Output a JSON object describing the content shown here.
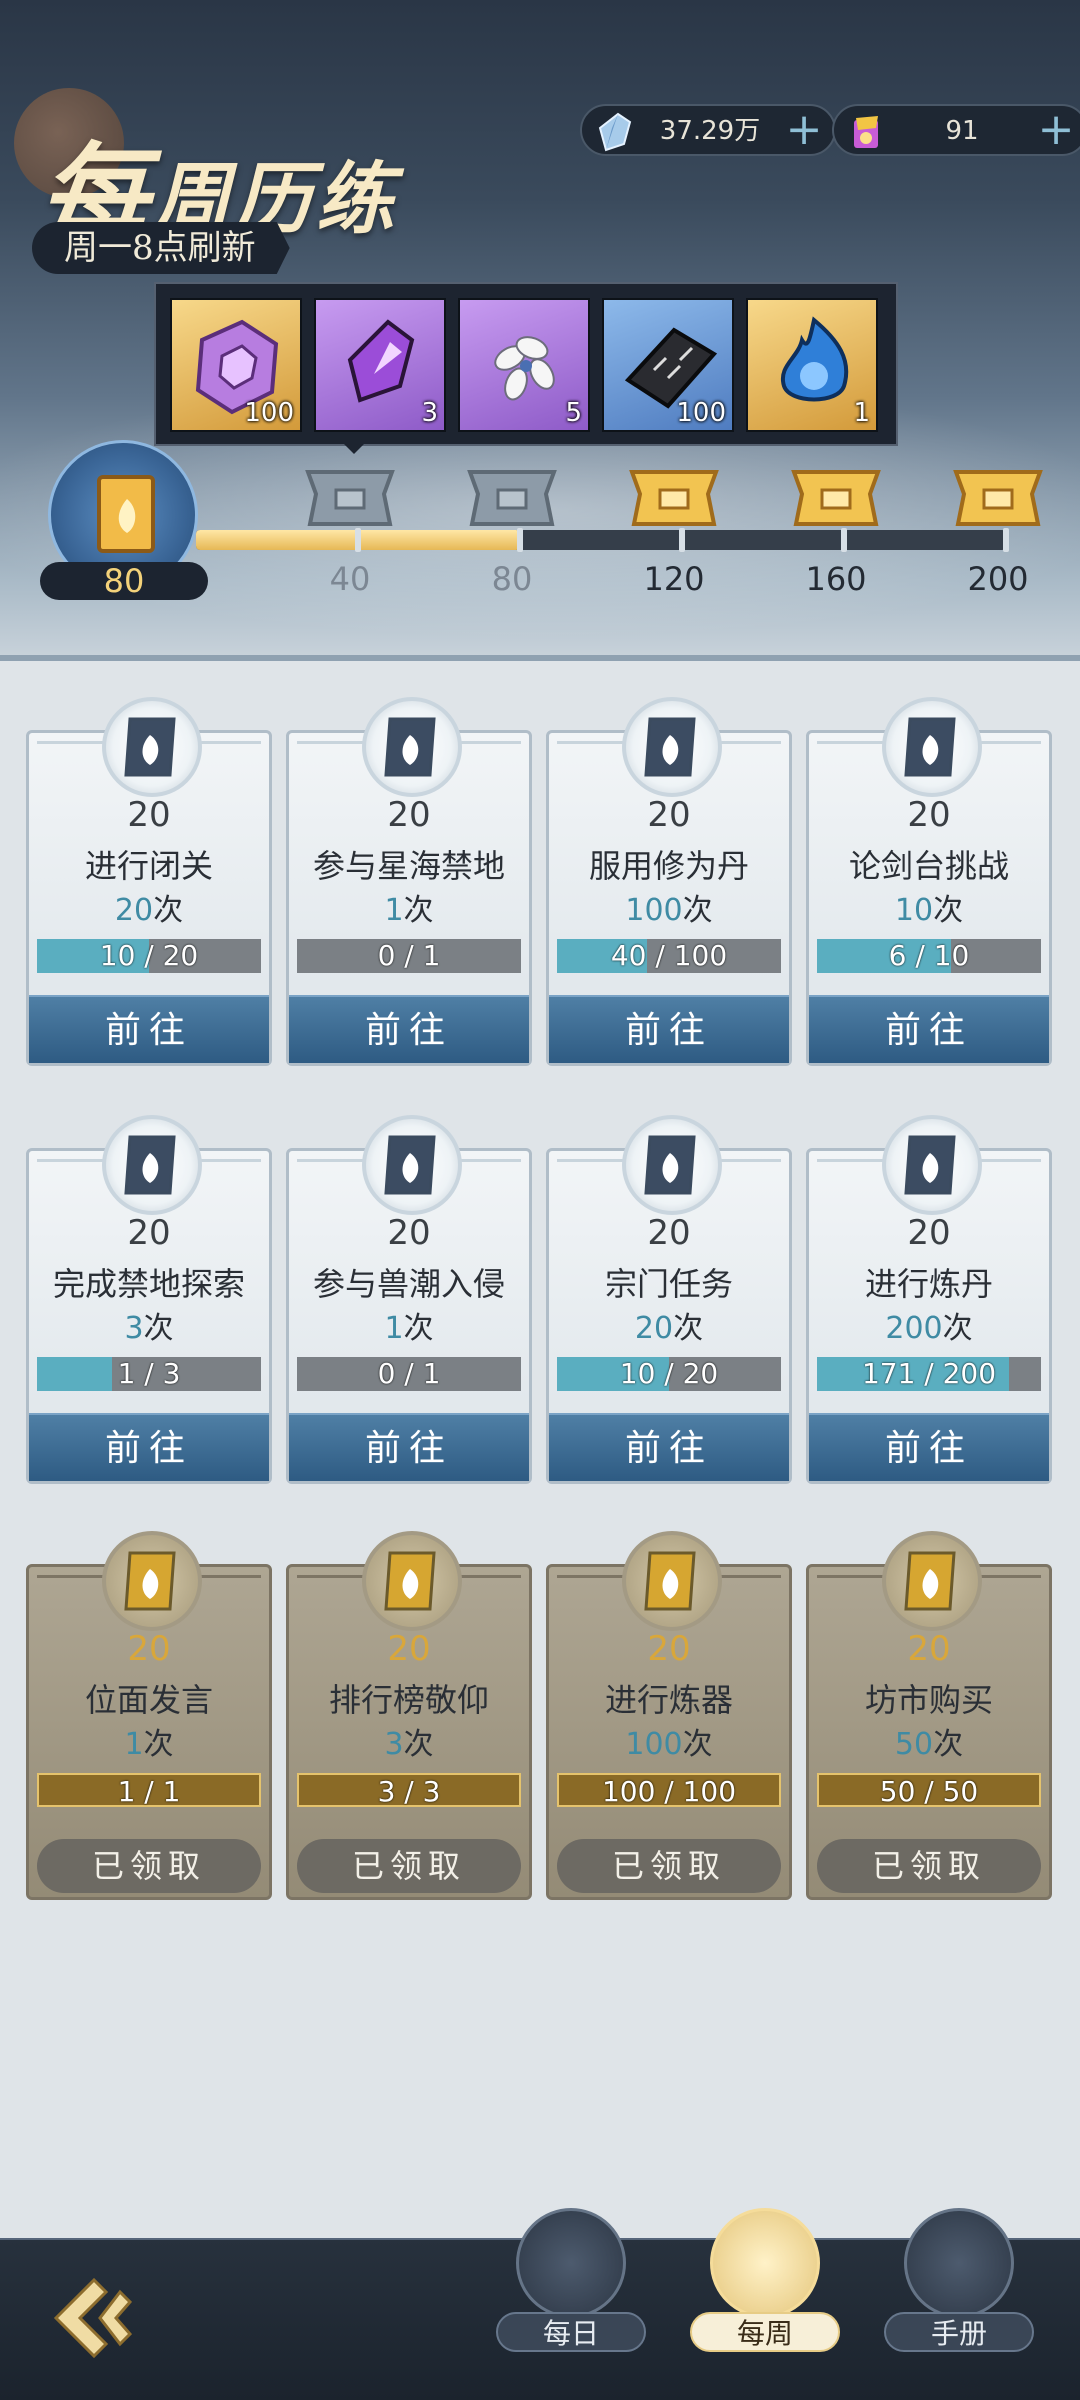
{
  "header": {
    "title_first": "每",
    "title_rest": "周历练",
    "refresh_note": "周一8点刷新"
  },
  "currencies": [
    {
      "icon": "spirit-stone-icon",
      "value": "37.29万",
      "plus": "+"
    },
    {
      "icon": "gold-scroll-icon",
      "value": "91",
      "plus": "+"
    }
  ],
  "reward_preview": [
    {
      "icon": "purple-ring-icon",
      "quality": "gold",
      "count": "100"
    },
    {
      "icon": "purple-crystal-icon",
      "quality": "purple",
      "count": "3"
    },
    {
      "icon": "white-flower-icon",
      "quality": "purple",
      "count": "5"
    },
    {
      "icon": "black-tablet-icon",
      "quality": "blue",
      "count": "100"
    },
    {
      "icon": "blue-flame-orb-icon",
      "quality": "gold",
      "count": "1"
    }
  ],
  "progress": {
    "current_score": "80",
    "max": 200,
    "milestones": [
      {
        "label": "40",
        "claimed": true
      },
      {
        "label": "80",
        "claimed": true
      },
      {
        "label": "120",
        "claimed": false
      },
      {
        "label": "160",
        "claimed": false
      },
      {
        "label": "200",
        "claimed": false
      }
    ]
  },
  "tasks": [
    {
      "points": "20",
      "name": "进行闭关",
      "count_num": "20",
      "count_unit": "次",
      "progress_text": "10 / 20",
      "progress_frac": 0.5,
      "button": "前往",
      "status": "open"
    },
    {
      "points": "20",
      "name": "参与星海禁地",
      "count_num": "1",
      "count_unit": "次",
      "progress_text": "0 / 1",
      "progress_frac": 0,
      "button": "前往",
      "status": "open"
    },
    {
      "points": "20",
      "name": "服用修为丹",
      "count_num": "100",
      "count_unit": "次",
      "progress_text": "40 / 100",
      "progress_frac": 0.4,
      "button": "前往",
      "status": "open"
    },
    {
      "points": "20",
      "name": "论剑台挑战",
      "count_num": "10",
      "count_unit": "次",
      "progress_text": "6 / 10",
      "progress_frac": 0.6,
      "button": "前往",
      "status": "open"
    },
    {
      "points": "20",
      "name": "完成禁地探索",
      "count_num": "3",
      "count_unit": "次",
      "progress_text": "1 / 3",
      "progress_frac": 0.333,
      "button": "前往",
      "status": "open"
    },
    {
      "points": "20",
      "name": "参与兽潮入侵",
      "count_num": "1",
      "count_unit": "次",
      "progress_text": "0 / 1",
      "progress_frac": 0,
      "button": "前往",
      "status": "open"
    },
    {
      "points": "20",
      "name": "宗门任务",
      "count_num": "20",
      "count_unit": "次",
      "progress_text": "10 / 20",
      "progress_frac": 0.5,
      "button": "前往",
      "status": "open"
    },
    {
      "points": "20",
      "name": "进行炼丹",
      "count_num": "200",
      "count_unit": "次",
      "progress_text": "171 / 200",
      "progress_frac": 0.855,
      "button": "前往",
      "status": "open"
    },
    {
      "points": "20",
      "name": "位面发言",
      "count_num": "1",
      "count_unit": "次",
      "progress_text": "1 / 1",
      "progress_frac": 1,
      "button": "已领取",
      "status": "claimed"
    },
    {
      "points": "20",
      "name": "排行榜敬仰",
      "count_num": "3",
      "count_unit": "次",
      "progress_text": "3 / 3",
      "progress_frac": 1,
      "button": "已领取",
      "status": "claimed"
    },
    {
      "points": "20",
      "name": "进行炼器",
      "count_num": "100",
      "count_unit": "次",
      "progress_text": "100 / 100",
      "progress_frac": 1,
      "button": "已领取",
      "status": "claimed"
    },
    {
      "points": "20",
      "name": "坊市购买",
      "count_num": "50",
      "count_unit": "次",
      "progress_text": "50 / 50",
      "progress_frac": 1,
      "button": "已领取",
      "status": "claimed"
    }
  ],
  "nav": {
    "tabs": [
      {
        "label": "每日",
        "icon": "flame-scroll-icon",
        "active": false
      },
      {
        "label": "每周",
        "icon": "flame-book-icon",
        "active": true
      },
      {
        "label": "手册",
        "icon": "manual-icon",
        "active": false
      }
    ],
    "back_icon": "back-arrow-icon"
  },
  "colors": {
    "accent_blue": "#3f8ba4",
    "progress_gold": "#e6b856",
    "claimed_gold": "#d9a73a"
  }
}
